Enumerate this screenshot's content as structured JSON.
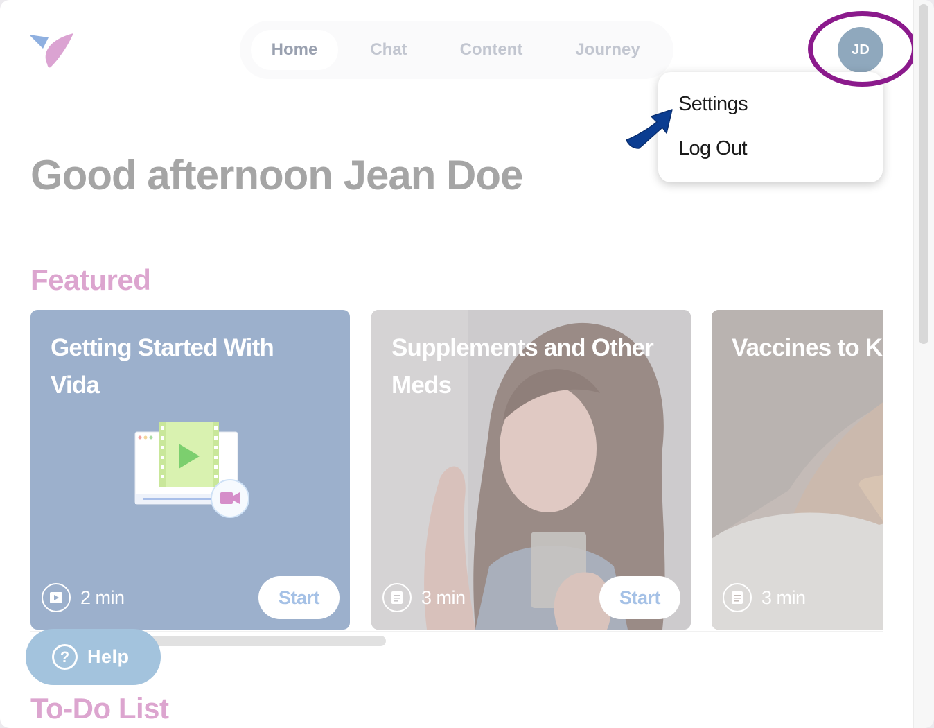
{
  "nav": {
    "tabs": [
      {
        "label": "Home",
        "active": true
      },
      {
        "label": "Chat",
        "active": false
      },
      {
        "label": "Content",
        "active": false
      },
      {
        "label": "Journey",
        "active": false
      }
    ]
  },
  "user": {
    "initials": "JD",
    "menu": {
      "settings_label": "Settings",
      "logout_label": "Log Out"
    }
  },
  "greeting": "Good afternoon Jean Doe",
  "featured": {
    "title": "Featured",
    "cards": [
      {
        "title": "Getting Started With Vida",
        "duration": "2 min",
        "icon": "play-icon",
        "button": "Start"
      },
      {
        "title": "Supplements and Other Meds",
        "duration": "3 min",
        "icon": "document-icon",
        "button": "Start"
      },
      {
        "title": "Vaccines to K",
        "duration": "3 min",
        "icon": "document-icon"
      }
    ]
  },
  "help": {
    "label": "Help"
  },
  "todo": {
    "title": "To-Do List"
  },
  "colors": {
    "highlight_ring": "#8b1a8c",
    "pointer_arrow": "#0b3d91",
    "featured_heading": "#dca5cf",
    "avatar_bg": "#8fa8bd"
  }
}
